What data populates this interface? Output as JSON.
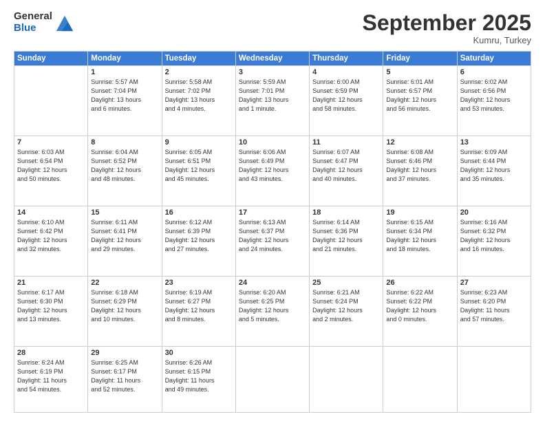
{
  "header": {
    "logo_general": "General",
    "logo_blue": "Blue",
    "month_title": "September 2025",
    "location": "Kumru, Turkey"
  },
  "weekdays": [
    "Sunday",
    "Monday",
    "Tuesday",
    "Wednesday",
    "Thursday",
    "Friday",
    "Saturday"
  ],
  "weeks": [
    [
      {
        "day": "",
        "info": ""
      },
      {
        "day": "1",
        "info": "Sunrise: 5:57 AM\nSunset: 7:04 PM\nDaylight: 13 hours\nand 6 minutes."
      },
      {
        "day": "2",
        "info": "Sunrise: 5:58 AM\nSunset: 7:02 PM\nDaylight: 13 hours\nand 4 minutes."
      },
      {
        "day": "3",
        "info": "Sunrise: 5:59 AM\nSunset: 7:01 PM\nDaylight: 13 hours\nand 1 minute."
      },
      {
        "day": "4",
        "info": "Sunrise: 6:00 AM\nSunset: 6:59 PM\nDaylight: 12 hours\nand 58 minutes."
      },
      {
        "day": "5",
        "info": "Sunrise: 6:01 AM\nSunset: 6:57 PM\nDaylight: 12 hours\nand 56 minutes."
      },
      {
        "day": "6",
        "info": "Sunrise: 6:02 AM\nSunset: 6:56 PM\nDaylight: 12 hours\nand 53 minutes."
      }
    ],
    [
      {
        "day": "7",
        "info": "Sunrise: 6:03 AM\nSunset: 6:54 PM\nDaylight: 12 hours\nand 50 minutes."
      },
      {
        "day": "8",
        "info": "Sunrise: 6:04 AM\nSunset: 6:52 PM\nDaylight: 12 hours\nand 48 minutes."
      },
      {
        "day": "9",
        "info": "Sunrise: 6:05 AM\nSunset: 6:51 PM\nDaylight: 12 hours\nand 45 minutes."
      },
      {
        "day": "10",
        "info": "Sunrise: 6:06 AM\nSunset: 6:49 PM\nDaylight: 12 hours\nand 43 minutes."
      },
      {
        "day": "11",
        "info": "Sunrise: 6:07 AM\nSunset: 6:47 PM\nDaylight: 12 hours\nand 40 minutes."
      },
      {
        "day": "12",
        "info": "Sunrise: 6:08 AM\nSunset: 6:46 PM\nDaylight: 12 hours\nand 37 minutes."
      },
      {
        "day": "13",
        "info": "Sunrise: 6:09 AM\nSunset: 6:44 PM\nDaylight: 12 hours\nand 35 minutes."
      }
    ],
    [
      {
        "day": "14",
        "info": "Sunrise: 6:10 AM\nSunset: 6:42 PM\nDaylight: 12 hours\nand 32 minutes."
      },
      {
        "day": "15",
        "info": "Sunrise: 6:11 AM\nSunset: 6:41 PM\nDaylight: 12 hours\nand 29 minutes."
      },
      {
        "day": "16",
        "info": "Sunrise: 6:12 AM\nSunset: 6:39 PM\nDaylight: 12 hours\nand 27 minutes."
      },
      {
        "day": "17",
        "info": "Sunrise: 6:13 AM\nSunset: 6:37 PM\nDaylight: 12 hours\nand 24 minutes."
      },
      {
        "day": "18",
        "info": "Sunrise: 6:14 AM\nSunset: 6:36 PM\nDaylight: 12 hours\nand 21 minutes."
      },
      {
        "day": "19",
        "info": "Sunrise: 6:15 AM\nSunset: 6:34 PM\nDaylight: 12 hours\nand 18 minutes."
      },
      {
        "day": "20",
        "info": "Sunrise: 6:16 AM\nSunset: 6:32 PM\nDaylight: 12 hours\nand 16 minutes."
      }
    ],
    [
      {
        "day": "21",
        "info": "Sunrise: 6:17 AM\nSunset: 6:30 PM\nDaylight: 12 hours\nand 13 minutes."
      },
      {
        "day": "22",
        "info": "Sunrise: 6:18 AM\nSunset: 6:29 PM\nDaylight: 12 hours\nand 10 minutes."
      },
      {
        "day": "23",
        "info": "Sunrise: 6:19 AM\nSunset: 6:27 PM\nDaylight: 12 hours\nand 8 minutes."
      },
      {
        "day": "24",
        "info": "Sunrise: 6:20 AM\nSunset: 6:25 PM\nDaylight: 12 hours\nand 5 minutes."
      },
      {
        "day": "25",
        "info": "Sunrise: 6:21 AM\nSunset: 6:24 PM\nDaylight: 12 hours\nand 2 minutes."
      },
      {
        "day": "26",
        "info": "Sunrise: 6:22 AM\nSunset: 6:22 PM\nDaylight: 12 hours\nand 0 minutes."
      },
      {
        "day": "27",
        "info": "Sunrise: 6:23 AM\nSunset: 6:20 PM\nDaylight: 11 hours\nand 57 minutes."
      }
    ],
    [
      {
        "day": "28",
        "info": "Sunrise: 6:24 AM\nSunset: 6:19 PM\nDaylight: 11 hours\nand 54 minutes."
      },
      {
        "day": "29",
        "info": "Sunrise: 6:25 AM\nSunset: 6:17 PM\nDaylight: 11 hours\nand 52 minutes."
      },
      {
        "day": "30",
        "info": "Sunrise: 6:26 AM\nSunset: 6:15 PM\nDaylight: 11 hours\nand 49 minutes."
      },
      {
        "day": "",
        "info": ""
      },
      {
        "day": "",
        "info": ""
      },
      {
        "day": "",
        "info": ""
      },
      {
        "day": "",
        "info": ""
      }
    ]
  ]
}
